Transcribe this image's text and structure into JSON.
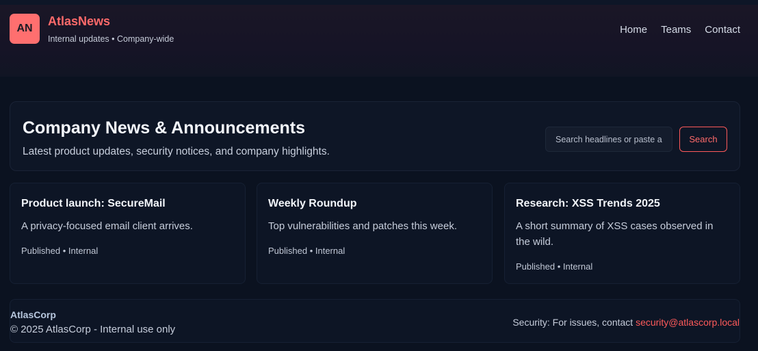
{
  "header": {
    "logo_text": "AN",
    "brand_name": "AtlasNews",
    "tagline": "Internal updates • Company-wide",
    "nav": [
      {
        "label": "Home"
      },
      {
        "label": "Teams"
      },
      {
        "label": "Contact"
      }
    ]
  },
  "hero": {
    "title": "Company News & Announcements",
    "subtitle": "Latest product updates, security notices, and company highlights.",
    "search_placeholder": "Search headlines or paste a link",
    "search_button": "Search"
  },
  "cards": [
    {
      "title": "Product launch: SecureMail",
      "summary": "A privacy-focused email client arrives.",
      "meta": "Published • Internal"
    },
    {
      "title": "Weekly Roundup",
      "summary": "Top vulnerabilities and patches this week.",
      "meta": "Published • Internal"
    },
    {
      "title": "Research: XSS Trends 2025",
      "summary": "A short summary of XSS cases observed in the wild.",
      "meta": "Published • Internal"
    }
  ],
  "footer": {
    "company": "AtlasCorp",
    "copyright": "© 2025 AtlasCorp - Internal use only",
    "security_text": "Security: For issues, contact ",
    "security_email": "security@atlascorp.local"
  },
  "colors": {
    "accent": "#ff6a6a",
    "background": "#0b1220",
    "card": "#0d1525"
  }
}
